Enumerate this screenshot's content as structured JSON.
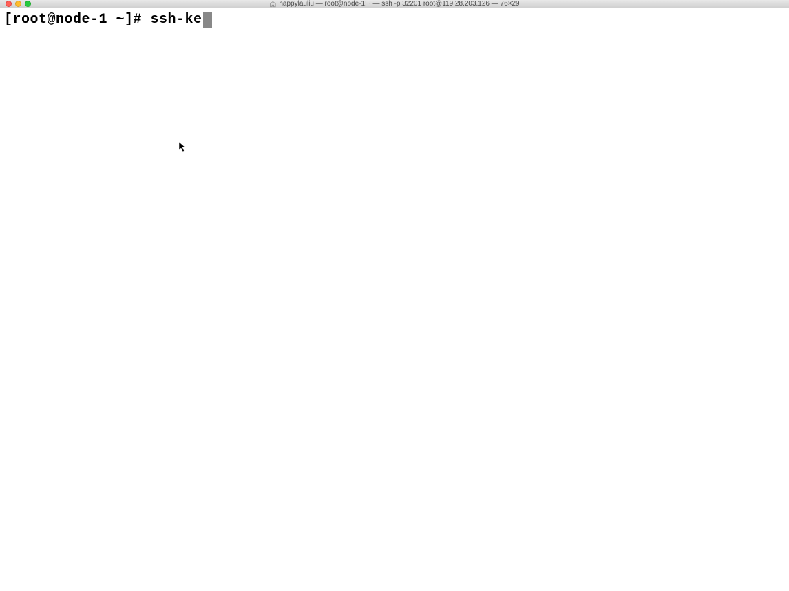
{
  "titlebar": {
    "title": "happylauliu — root@node-1:~ — ssh -p 32201 root@119.28.203.126 — 76×29"
  },
  "terminal": {
    "prompt": "[root@node-1 ~]# ",
    "command": "ssh-ke"
  }
}
